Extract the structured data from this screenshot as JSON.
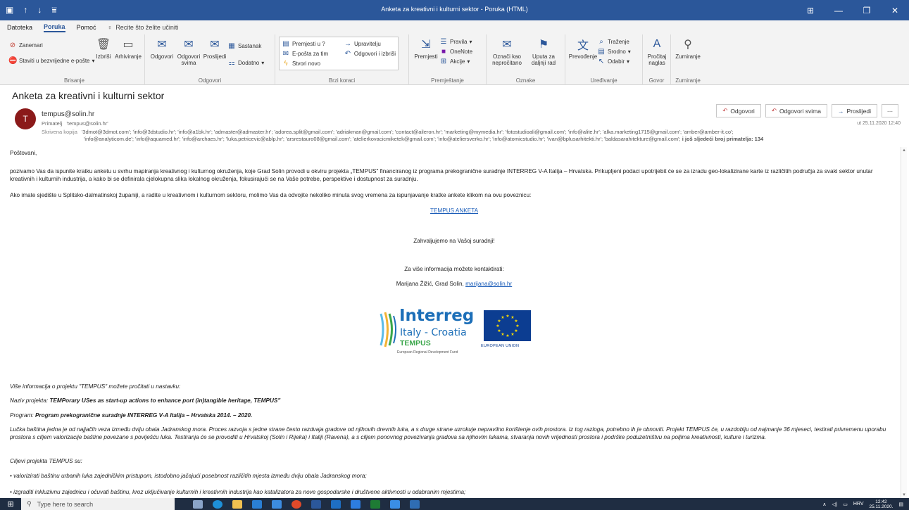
{
  "window": {
    "title": "Anketa za kreativni i kulturni sektor - Poruka (HTML)"
  },
  "tabs": {
    "items": [
      "Datoteka",
      "Poruka",
      "Pomoć"
    ],
    "tellme": "Recite što želite učiniti"
  },
  "ribbon": {
    "brisanje": {
      "label": "Brisanje",
      "zanemari": "Zanemari",
      "blokiraj": "Staviti u bezvrijedne e-pošte",
      "izbrisi": "Izbriši",
      "arhiviranje": "Arhiviranje"
    },
    "odgovori": {
      "label": "Odgovori",
      "odgovori": "Odgovori",
      "odgovori_svima": "Odgovori svima",
      "proslijedi": "Proslijedi",
      "sastanak": "Sastanak",
      "dodatno": "Dodatno"
    },
    "brzi_koraci": {
      "label": "Brzi koraci",
      "items": [
        "Premjesti u ?",
        "Upravitelju",
        "E-pošta za tim",
        "Odgovori i izbriši",
        "Stvori novo"
      ]
    },
    "premjestanje": {
      "label": "Premještanje",
      "premjesti": "Premjesti",
      "pravila": "Pravila",
      "onenote": "OneNote",
      "akcije": "Akcije"
    },
    "oznake": {
      "label": "Oznake",
      "neprocitano": "Označi kao nepročitano",
      "upute": "Uputa za daljnji rad"
    },
    "uredivanje": {
      "label": "Uređivanje",
      "prevodenje": "Prevođenje",
      "trazenje": "Traženje",
      "srodno": "Srodno",
      "odabir": "Odabir"
    },
    "govor": {
      "label": "Govor",
      "procitaj": "Pročitaj naglas"
    },
    "zumiranje": {
      "label": "Zumiranje",
      "zumiranje": "Zumiranje"
    }
  },
  "message": {
    "subject": "Anketa za kreativni i kulturni sektor",
    "avatar_letter": "T",
    "sender": "tempus@solin.hr",
    "recipient_label": "Primatelj",
    "recipient": "tempus@solin.hr",
    "bcc_label": "Skrivena kopija",
    "bcc_line1": "'3dmot@3dmot.com'; 'info@3dstudio.hr'; 'info@a1bk.hr'; 'admaster@admaster.hr'; 'adorea.split@gmail.com'; 'adriakman@gmail.com'; 'contact@aileron.hr'; 'marketing@mymedia.hr'; 'fotostudioali@gmail.com'; 'info@alite.hr'; 'alka.marketing1715@gmail.com'; 'amber@amber-it.co';",
    "bcc_line2": "'info@analyticom.de'; 'info@aquamed.hr'; 'info@archaes.hr'; 'luka.petricevic@ablp.hr'; 'arsrestauro08@gmail.com'; 'atelierkovacicmiketek@gmail.com'; 'info@ateliersverko.hr'; 'info@atomicstudio.hr'; 'ivan@bplusarhitekti.hr'; 'baldasarahitekture@gmail.com';",
    "bcc_more": "i još sljedeći broj primatelja: 134",
    "sent": "ut 25.11.2020 12:40",
    "actions": {
      "reply": "Odgovori",
      "reply_all": "Odgovori svima",
      "forward": "Proslijedi",
      "more": "···"
    }
  },
  "body": {
    "greeting": "Poštovani,",
    "para1": "pozivamo Vas da ispunite kratku anketu u svrhu mapiranja kreativnog i kulturnog okruženja, koje Grad Solin provodi u okviru projekta „TEMPUS\" financiranog iz programa prekogranične suradnje INTERREG V-A Italija – Hrvatska. Prikupljeni podaci upotrijebit će se za izradu geo-lokalizirane karte iz različitih područja za svaki sektor unutar kreativnih i kulturnih industrija, a kako bi se definirala cjelokupna slika lokalnog okruženja, fokusirajući se na Vaše potrebe, perspektive i dostupnost za suradnju.",
    "para2": "Ako imate sjedište u Splitsko-dalmatinskoj županiji, a radite u kreativnom i kulturnom sektoru, molimo Vas da odvojite nekoliko minuta svog vremena za ispunjavanje kratke ankete klikom na ovu poveznicu:",
    "link": "TEMPUS ANKETA",
    "thanks": "Zahvaljujemo na Vašoj suradnji!",
    "contact_title": "Za više informacija možete kontaktirati:",
    "contact_name": "Marijana Žižić, Grad Solin, ",
    "contact_email": "marijana@solin.hr",
    "more_info": "Više informacija o projektu \"TEMPUS\" možete pročitati u nastavku:",
    "naziv_label": "Naziv projekta: ",
    "naziv_value": "TEMPorary USes as start-up actions to enhance port (in)tangible heritage, TEMPUS\"",
    "program_label": "Program: ",
    "program_value": "Program prekogranične suradnje INTERREG V-A Italija – Hrvatska 2014. – 2020.",
    "para3": "Lučka baština jedna je od najjačih veza između dviju obala Jadranskog mora. Proces razvoja s jedne strane često razdvaja gradove od njihovih drevnih luka, a s druge strane uzrokuje nepravilno korištenje ovih prostora. Iz tog razloga, potrebno ih je obnoviti. Projekt TEMPUS će, u razdoblju od najmanje 36 mjeseci, testirati privremenu uporabu prostora s ciljem valorizacije baštine povezane s poviješću luka. Testiranja će se provoditi u Hrvatskoj (Solin i Rijeka) i Italiji (Ravena), a s ciljem ponovnog povezivanja gradova sa njihovim lukama, stvaranja novih vrijednosti prostora i podrške poduzetništvu na poljima kreativnosti, kulture i turizma.",
    "goals_title": "Ciljevi projekta TEMPUS su:",
    "goal1": "• valorizirati baštinu urbanih luka zajedničkim pristupom, istodobno jačajući posebnost različitih mjesta između dviju obala Jadranskog mora;",
    "goal2": "• izgraditi inkluzivnu zajednicu i očuvati baštinu, kroz uključivanje kulturnih i kreativnih industrija kao katalizatora za nove gospodarske i društvene aktivnosti u odabranim mjestima;"
  },
  "logo": {
    "interreg": "Interreg",
    "region": "Italy - Croatia",
    "project": "TEMPUS",
    "fund": "European Regional Development Fund",
    "eu": "EUROPEAN UNION"
  },
  "taskbar": {
    "search_placeholder": "Type here to search",
    "lang": "HRV",
    "time": "12:42",
    "date": "25.11.2020."
  }
}
